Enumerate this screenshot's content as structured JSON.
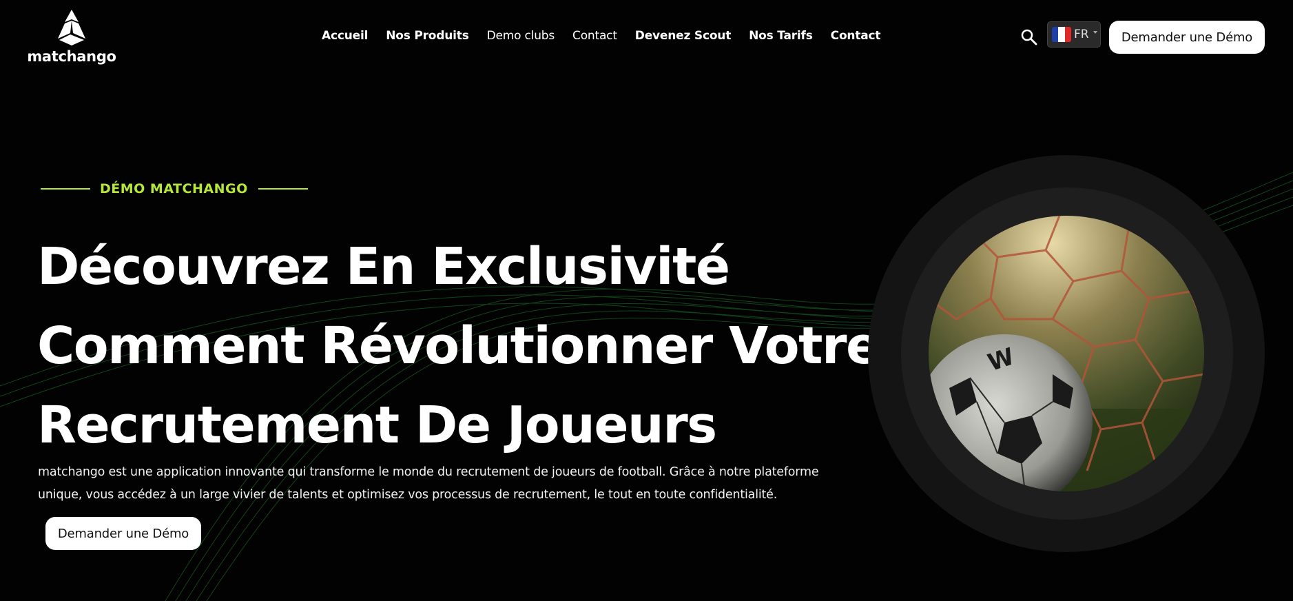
{
  "brand": {
    "name": "matchango"
  },
  "nav": {
    "items": [
      {
        "label": "Accueil"
      },
      {
        "label": "Nos Produits"
      },
      {
        "label": "Demo clubs"
      },
      {
        "label": "Contact"
      },
      {
        "label": "Devenez Scout"
      },
      {
        "label": "Nos Tarifs"
      },
      {
        "label": "Contact"
      }
    ]
  },
  "header": {
    "language": {
      "code": "FR",
      "flag": "fr-flag-icon"
    },
    "cta_label": "Demander une Démo"
  },
  "hero": {
    "eyebrow": "DÉMO MATCHANGO",
    "headline_lines": [
      "Découvrez En Exclusivité",
      "Comment Révolutionner Votre",
      "Recrutement De Joueurs"
    ],
    "description": "matchango est une application innovante qui transforme le monde du recrutement de joueurs de football. Grâce à notre plateforme unique, vous accédez à un large vivier de talents et optimisez vos processus de recrutement, le tout en toute confidentialité.",
    "cta_label": "Demander une Démo",
    "image_alt": "Ballon de football dans le filet"
  },
  "colors": {
    "background": "#020202",
    "accent": "#b5e83a",
    "button_bg": "#ffffff",
    "button_text": "#111111"
  }
}
